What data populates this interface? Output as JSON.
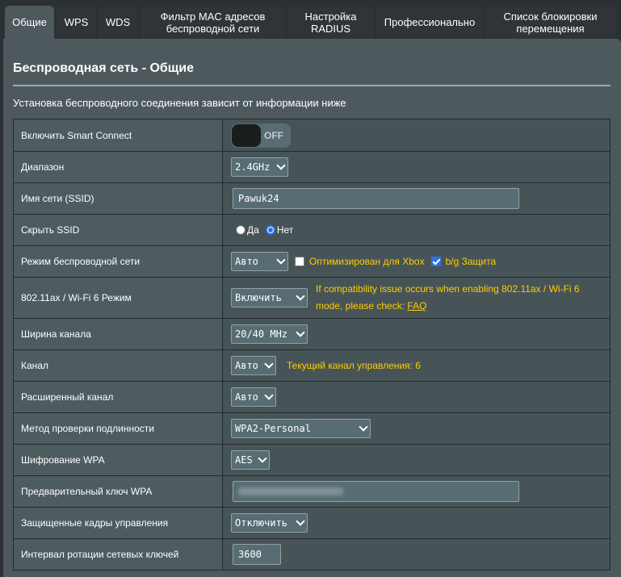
{
  "tabs": [
    {
      "label": "Общие",
      "active": true
    },
    {
      "label": "WPS"
    },
    {
      "label": "WDS"
    },
    {
      "label": "Фильтр MAC адресов\nбеспроводной сети"
    },
    {
      "label": "Настройка\nRADIUS"
    },
    {
      "label": "Профессионально"
    },
    {
      "label": "Список блокировки\nперемещения"
    }
  ],
  "panel": {
    "title": "Беспроводная сеть - Общие",
    "description": "Установка беспроводного соединения зависит от информации ниже"
  },
  "rows": {
    "smart_connect": {
      "label": "Включить Smart Connect",
      "toggle_state": "OFF"
    },
    "band": {
      "label": "Диапазон",
      "value": "2.4GHz"
    },
    "ssid": {
      "label": "Имя сети (SSID)",
      "value": "Pawuk24"
    },
    "hide_ssid": {
      "label": "Скрыть SSID",
      "option_yes": "Да",
      "option_no": "Нет",
      "selected": "Нет"
    },
    "wireless_mode": {
      "label": "Режим беспроводной сети",
      "value": "Авто",
      "xbox_label": "Оптимизирован для Xbox",
      "xbox_checked": false,
      "bg_label": "b/g Защита",
      "bg_checked": true
    },
    "wifi6": {
      "label": "802.11ax / Wi-Fi 6 Режим",
      "value": "Включить",
      "hint": "If compatibility issue occurs when enabling 802.11ax / Wi-Fi 6 mode, please check:",
      "hint_link": "FAQ"
    },
    "channel_width": {
      "label": "Ширина канала",
      "value": "20/40 MHz"
    },
    "channel": {
      "label": "Канал",
      "value": "Авто",
      "hint": "Текущий канал управления: 6"
    },
    "ext_channel": {
      "label": "Расширенный канал",
      "value": "Авто"
    },
    "auth": {
      "label": "Метод проверки подлинности",
      "value": "WPA2-Personal"
    },
    "wpa_enc": {
      "label": "Шифрование WPA",
      "value": "AES"
    },
    "wpa_key": {
      "label": "Предварительный ключ WPA"
    },
    "pmf": {
      "label": "Защищенные кадры управления",
      "value": "Отключить"
    },
    "rotation": {
      "label": "Интервал ротации сетевых ключей",
      "value": "3600"
    }
  },
  "colors": {
    "accent_hint": "#ffcc00",
    "panel_bg": "#4d595d",
    "page_bg": "#2b3033"
  }
}
